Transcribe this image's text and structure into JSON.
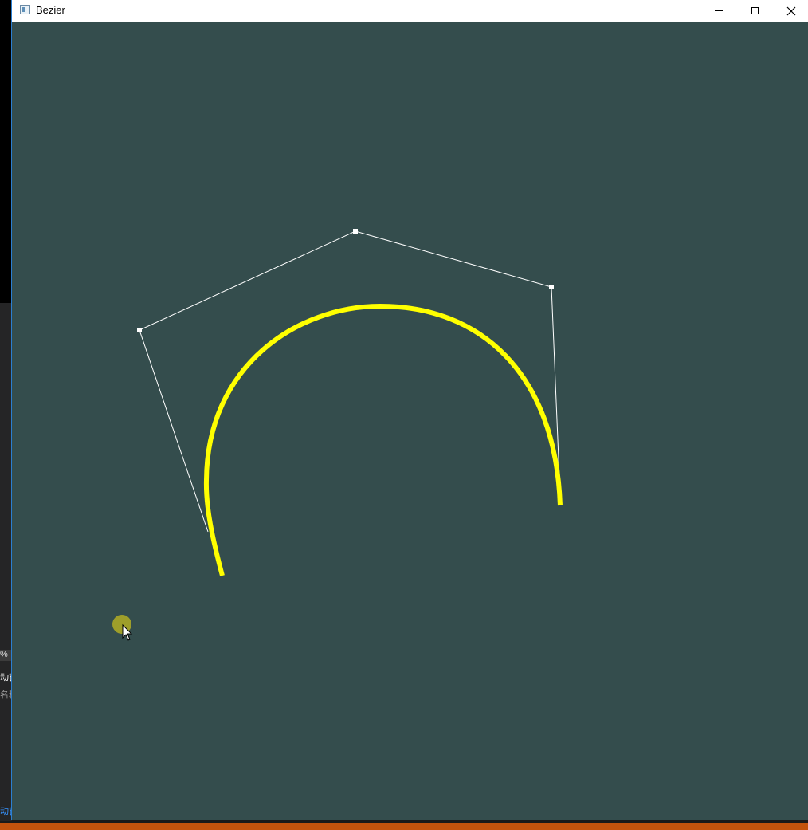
{
  "window": {
    "title": "Bezier",
    "controls": {
      "minimize_icon": "minimize-icon",
      "maximize_icon": "maximize-icon",
      "close_icon": "close-icon"
    }
  },
  "canvas": {
    "background": "#344d4d",
    "curve_color": "#ffff00",
    "polygon_color": "#ffffff",
    "cursor_highlight_color": "#9e9e2a"
  },
  "backdrop": {
    "frag_pct": "%",
    "frag_1": "动窗",
    "frag_2": "名称",
    "frag_3": "动窗"
  }
}
